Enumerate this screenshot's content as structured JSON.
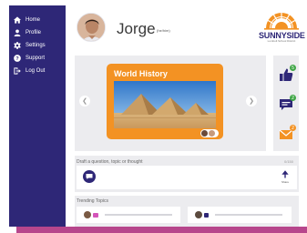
{
  "nav": {
    "items": [
      {
        "label": "Home",
        "icon": "home-icon"
      },
      {
        "label": "Profile",
        "icon": "profile-icon"
      },
      {
        "label": "Settings",
        "icon": "gear-icon"
      },
      {
        "label": "Support",
        "icon": "help-icon"
      },
      {
        "label": "Log Out",
        "icon": "logout-icon"
      }
    ]
  },
  "header": {
    "user_name": "Jorge",
    "user_role": "(he/him)",
    "brand": "SUNNYSIDE",
    "brand_sub": "Lumbolt School District"
  },
  "carousel": {
    "card_title": "World History",
    "prev_icon": "chevron-left-icon",
    "next_icon": "chevron-right-icon"
  },
  "rail": {
    "likes_badge": "5",
    "messages_badge": "2",
    "mail_badge": "2"
  },
  "compose": {
    "label": "Draft a question, topic or thought",
    "count": "0/150",
    "send_label": "Share"
  },
  "topics": {
    "label": "Trending Topics"
  },
  "colors": {
    "sidebar": "#2e2777",
    "accent": "#f39223",
    "panel": "#ececef",
    "badge_green": "#3fa646",
    "bottom_bar": "#b7468c"
  }
}
